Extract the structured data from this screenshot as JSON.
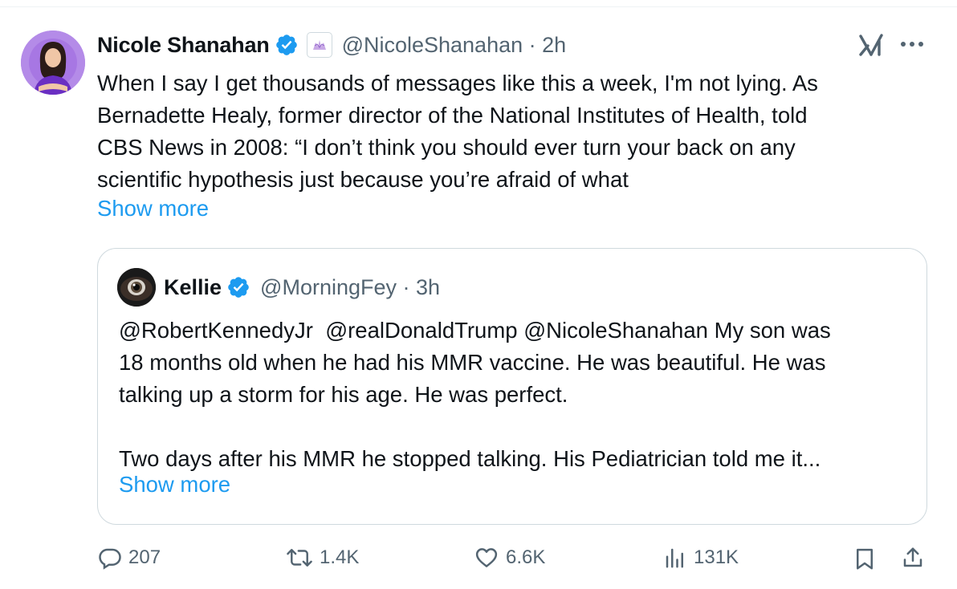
{
  "tweet": {
    "author": {
      "display_name": "Nicole Shanahan",
      "handle_time": "@NicoleShanahan · 2h",
      "verified_icon": "verified-badge-icon",
      "affiliate_icon": "affiliate-badge-icon"
    },
    "text": "When I say I get thousands of messages like this a week, I'm not lying. As\nBernadette Healy, former director of the National Institutes of Health, told\nCBS News in 2008: “I don’t think you should ever turn your back on any\nscientific hypothesis just because you’re afraid of what",
    "show_more": "Show more",
    "quote": {
      "display_name": "Kellie",
      "handle_time": "@MorningFey · 3h",
      "text": "@RobertKennedyJr  @realDonaldTrump @NicoleShanahan My son was\n18 months old when he had his MMR vaccine. He was beautiful. He was\ntalking up a storm for his age. He was perfect.\n\nTwo days after his MMR he stopped talking. His Pediatrician told me it...",
      "show_more": "Show more"
    },
    "actions": {
      "replies": "207",
      "reposts": "1.4K",
      "likes": "6.6K",
      "views": "131K"
    }
  },
  "colors": {
    "text": "#0f1419",
    "secondary": "#536471",
    "link": "#1d9bf0",
    "verified": "#1d9bf0",
    "border": "#cfd9de"
  }
}
